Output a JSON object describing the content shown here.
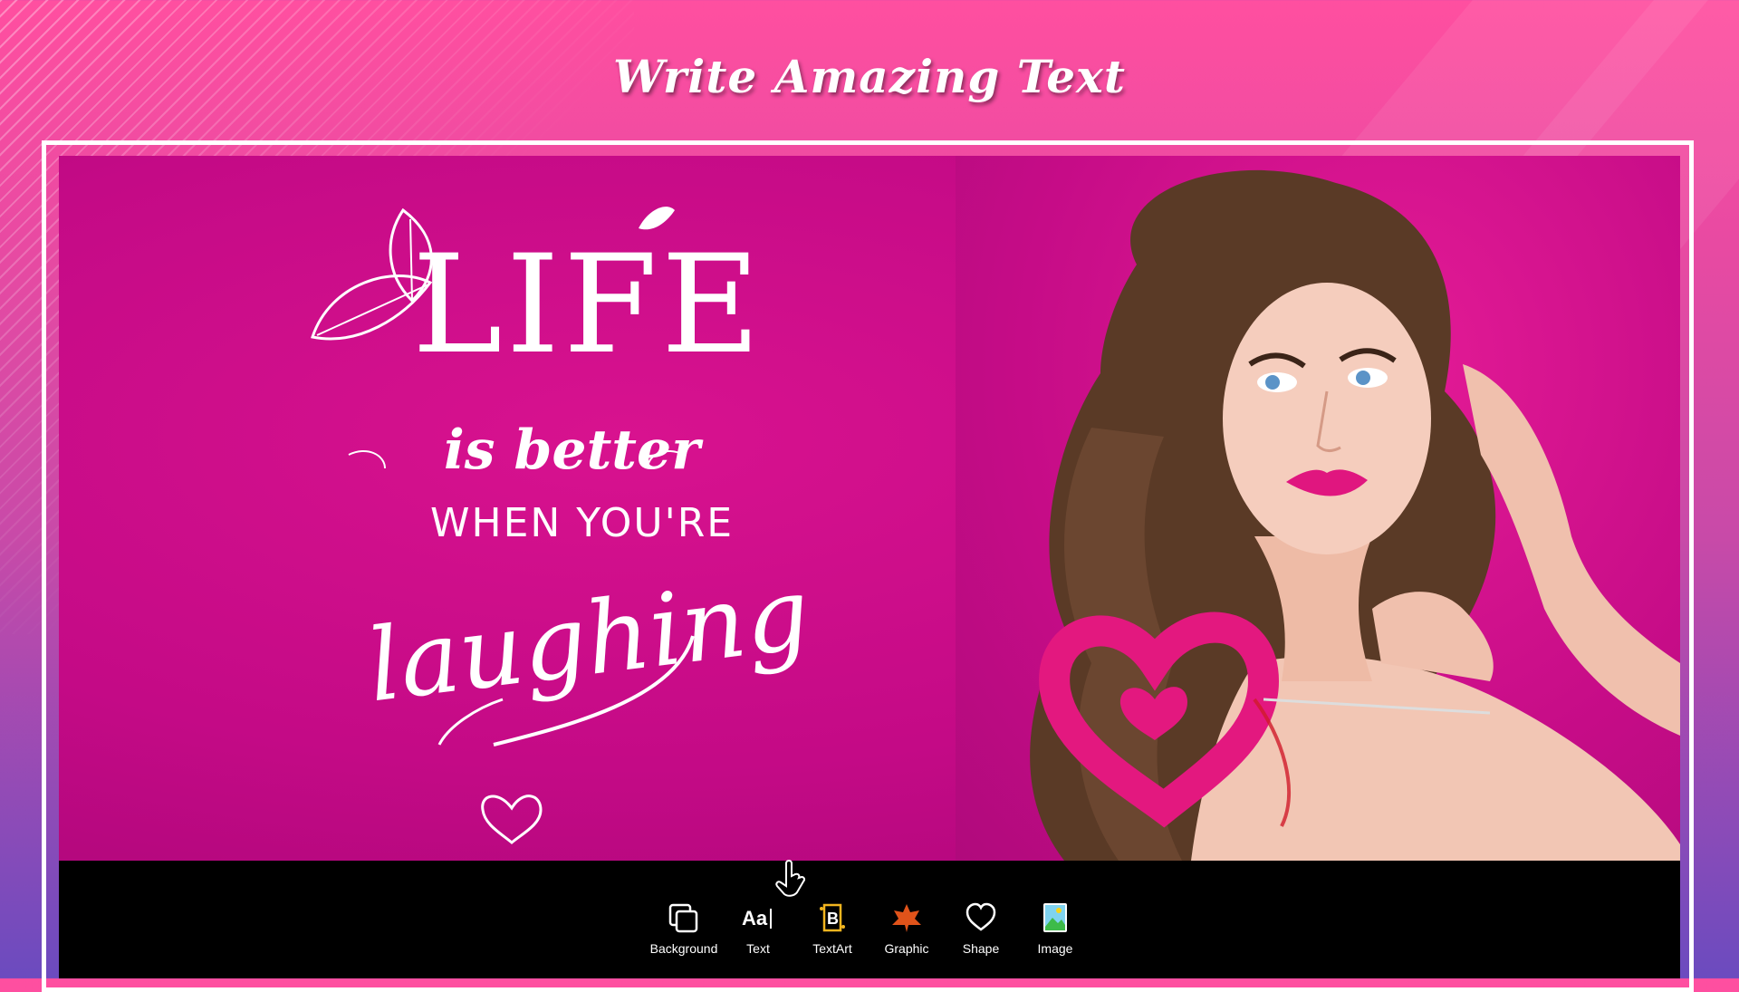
{
  "header": {
    "title": "Write Amazing Text"
  },
  "canvas": {
    "quote": {
      "line1": "LIFE",
      "line2": "is better",
      "line3": "WHEN YOU'RE",
      "line4": "laughing"
    }
  },
  "toolbar": {
    "items": [
      {
        "label": "Background",
        "icon": "background-icon"
      },
      {
        "label": "Text",
        "icon": "text-icon"
      },
      {
        "label": "TextArt",
        "icon": "textart-icon"
      },
      {
        "label": "Graphic",
        "icon": "graphic-icon"
      },
      {
        "label": "Shape",
        "icon": "shape-icon"
      },
      {
        "label": "Image",
        "icon": "image-icon"
      }
    ]
  },
  "colors": {
    "canvas_bg": "#c40a86",
    "accent": "#ff4fa0",
    "toolbar_bg": "#000000"
  }
}
